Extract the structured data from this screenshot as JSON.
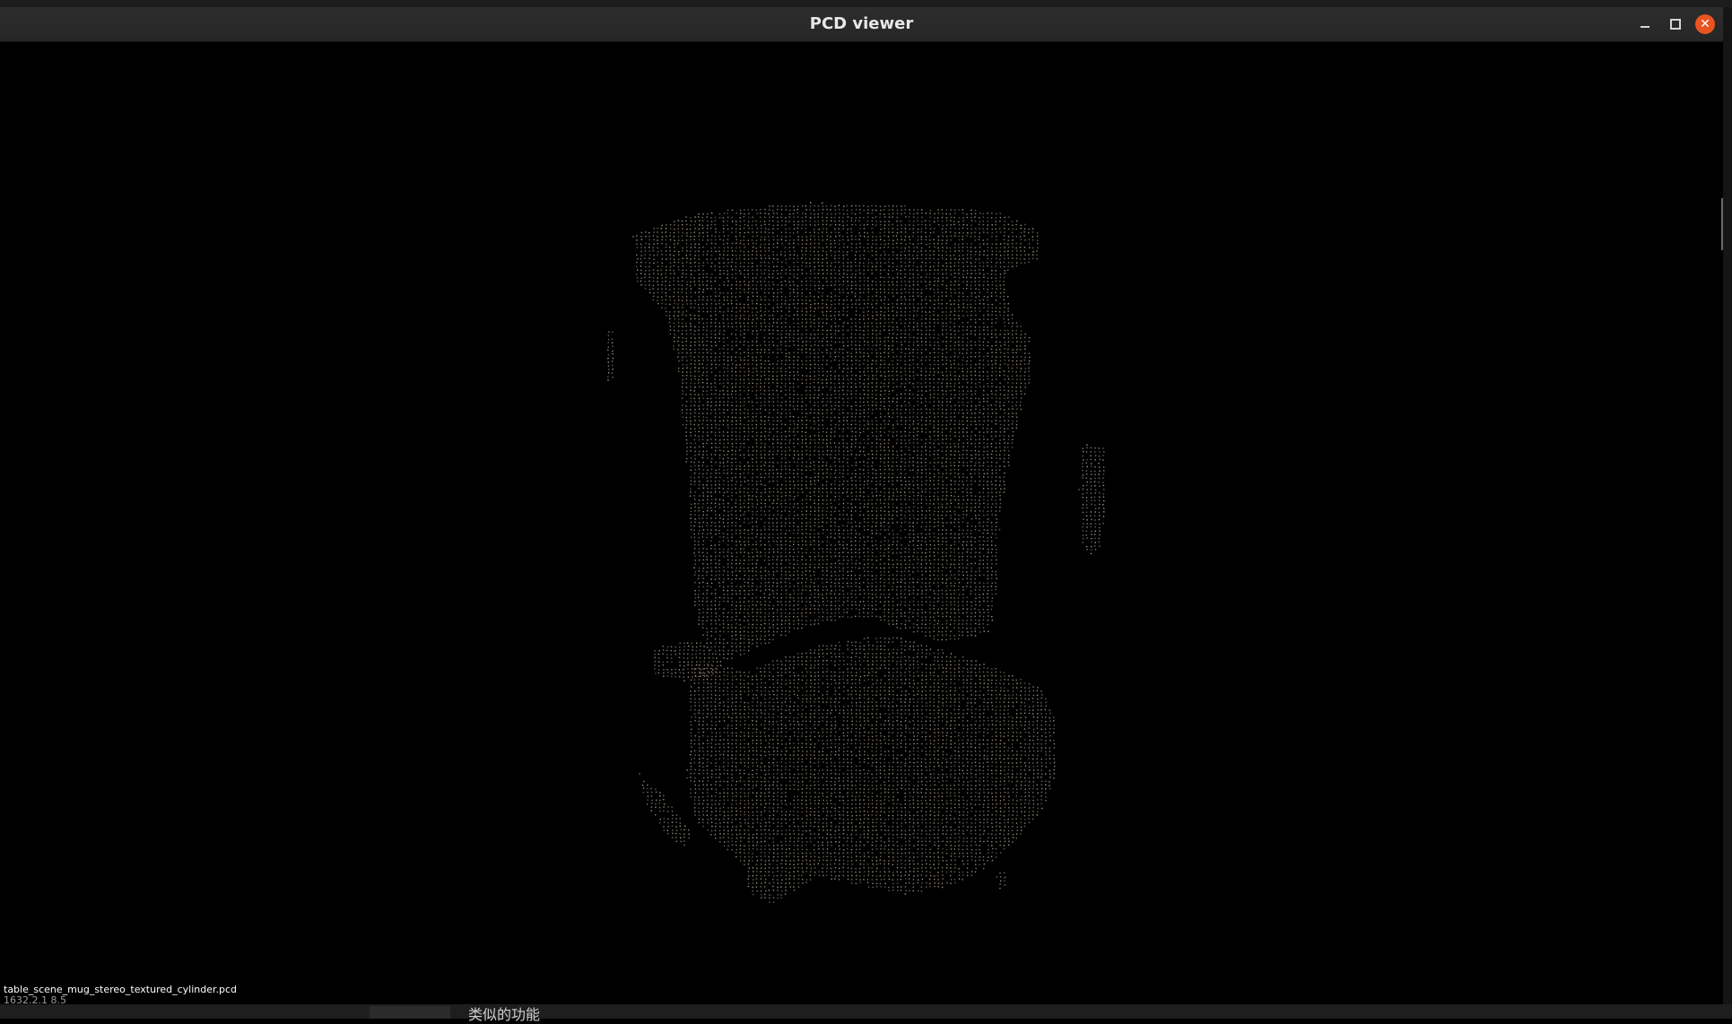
{
  "window": {
    "title": "PCD viewer",
    "buttons": {
      "minimize": "minimize",
      "maximize": "maximize",
      "close": "✕"
    }
  },
  "viewport": {
    "background": "#000000",
    "point_color": "#a69a8c",
    "filename": "table_scene_mug_stereo_textured_cylinder.pcd",
    "coords": "1632.2.1 8.5"
  },
  "background_app": {
    "bottom_text": "类似的功能"
  },
  "colors": {
    "titlebar": "#2a2a2a",
    "close_button": "#e95420",
    "title_text": "#e8e8e8"
  }
}
